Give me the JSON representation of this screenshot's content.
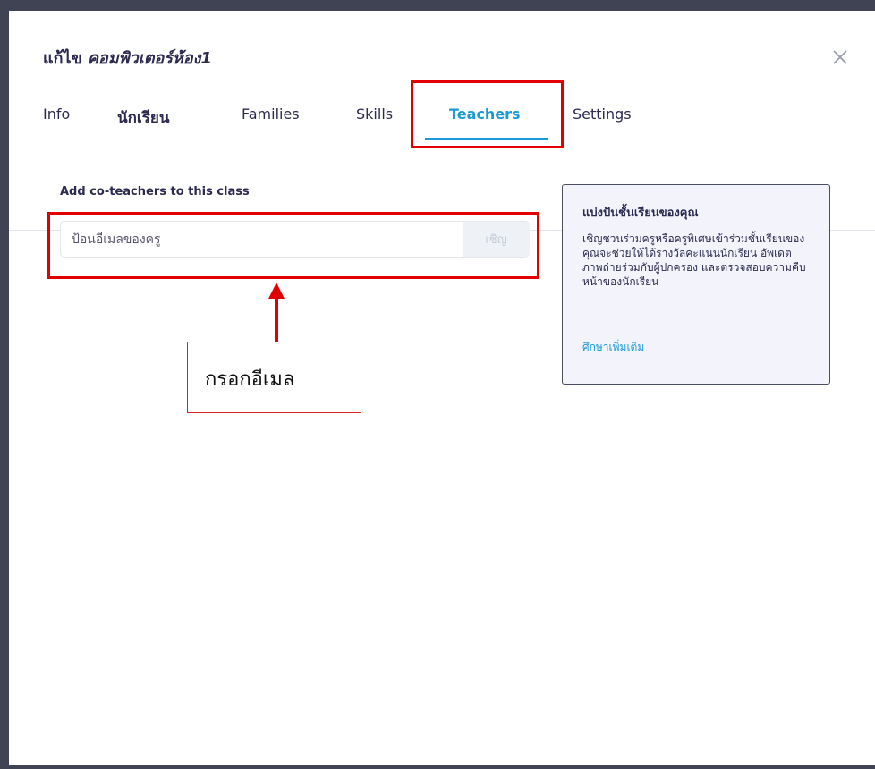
{
  "dialog": {
    "title_prefix": "แก้ไข",
    "class_name": "คอมพิวเตอร์ห้อง1"
  },
  "tabs": [
    {
      "label": "Info",
      "active": false
    },
    {
      "label": "นักเรียน",
      "active": false
    },
    {
      "label": "Families",
      "active": false
    },
    {
      "label": "Skills",
      "active": false
    },
    {
      "label": "Teachers",
      "active": true
    },
    {
      "label": "Settings",
      "active": false
    }
  ],
  "teachers_panel": {
    "add_label": "Add co-teachers to this class",
    "email_placeholder": "ป้อนอีเมลของครู",
    "email_value": "",
    "invite_button": "เชิญ"
  },
  "annotation": {
    "callout_text": "กรอกอีเมล",
    "color": "#e00000"
  },
  "info_card": {
    "heading": "แบ่งปันชั้นเรียนของคุณ",
    "body": "เชิญชวนร่วมครูหรือครูพิเศษเข้าร่วมชั้นเรียนของคุณจะช่วยให้ได้รางวัลคะแนนนักเรียน อัพเดตภาพถ่ายร่วมกับผู้ปกครอง และตรวจสอบความคืบหน้าของนักเรียน",
    "link": "ศึกษาเพิ่มเติม"
  },
  "colors": {
    "accent": "#1a9ad6",
    "text": "#2c2a50",
    "frame": "#3f4354",
    "highlight": "#e00000"
  },
  "icons": {
    "close": "close-icon"
  }
}
